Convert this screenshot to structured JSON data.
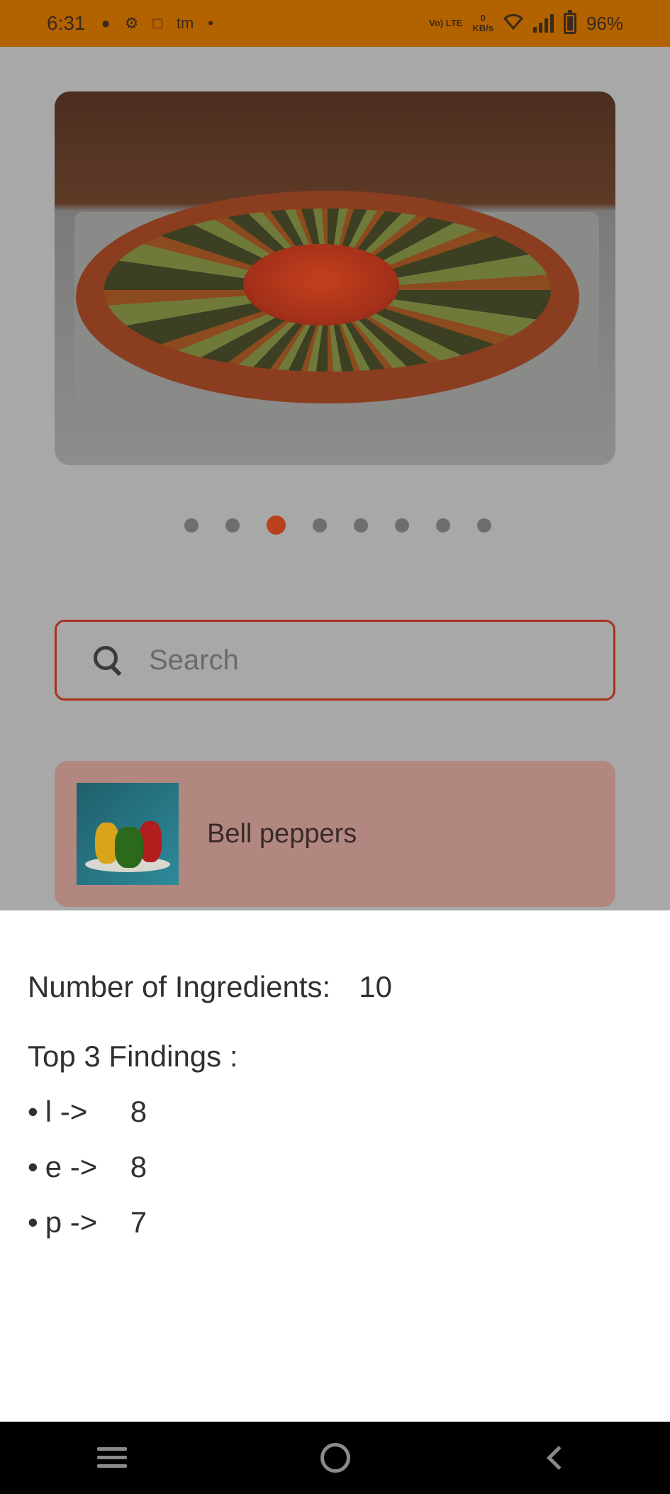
{
  "status_bar": {
    "time": "6:31",
    "net_type": "Vo) LTE",
    "net_speed_value": "0",
    "net_speed_unit": "KB/s",
    "battery": "96%"
  },
  "carousel": {
    "image_alt": "Ratatouille",
    "dot_count": 8,
    "active_index": 2
  },
  "search": {
    "placeholder": "Search"
  },
  "ingredient_card": {
    "label": "Bell peppers"
  },
  "sheet": {
    "count_label": "Number of Ingredients:",
    "count_value": "10",
    "findings_title": "Top 3 Findings :",
    "findings": [
      {
        "bullet": "•",
        "letter": "l ->",
        "count": "8"
      },
      {
        "bullet": "•",
        "letter": "e ->",
        "count": "8"
      },
      {
        "bullet": "•",
        "letter": "p ->",
        "count": "7"
      }
    ]
  },
  "colors": {
    "status_bar": "#b36200",
    "accent": "#b8401a",
    "card_bg": "#b18780"
  }
}
